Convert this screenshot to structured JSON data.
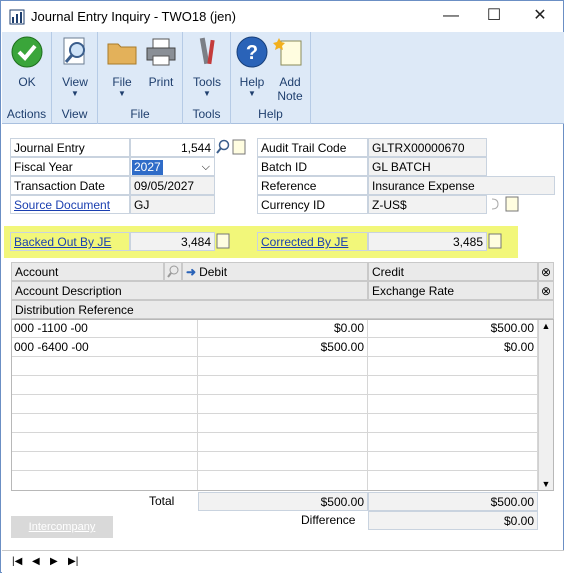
{
  "window": {
    "title": "Journal Entry Inquiry  -  TWO18 (jen)"
  },
  "ribbon": {
    "groups": [
      {
        "label": "Actions",
        "buttons": [
          {
            "label": "OK",
            "icon": "check-icon"
          }
        ]
      },
      {
        "label": "View",
        "buttons": [
          {
            "label": "View",
            "icon": "magnifier-document-icon"
          }
        ]
      },
      {
        "label": "File",
        "buttons": [
          {
            "label": "File",
            "icon": "folder-icon"
          },
          {
            "label": "Print",
            "icon": "printer-icon"
          }
        ]
      },
      {
        "label": "Tools",
        "buttons": [
          {
            "label": "Tools",
            "icon": "tools-icon"
          }
        ]
      },
      {
        "label": "Help",
        "buttons": [
          {
            "label": "Help",
            "icon": "help-icon"
          },
          {
            "label": "Add Note",
            "icon": "add-note-icon"
          }
        ]
      }
    ]
  },
  "form": {
    "journal_entry_label": "Journal Entry",
    "journal_entry_value": "1,544",
    "fiscal_year_label": "Fiscal Year",
    "fiscal_year_value": "2027",
    "transaction_date_label": "Transaction Date",
    "transaction_date_value": "09/05/2027",
    "source_document_label": "Source Document",
    "source_document_value": "GJ",
    "audit_trail_label": "Audit Trail Code",
    "audit_trail_value": "GLTRX00000670",
    "batch_id_label": "Batch ID",
    "batch_id_value": "GL BATCH",
    "reference_label": "Reference",
    "reference_value": "Insurance Expense",
    "currency_id_label": "Currency ID",
    "currency_id_value": "Z-US$",
    "backed_out_label": "Backed Out By JE",
    "backed_out_value": "3,484",
    "corrected_label": "Corrected By JE",
    "corrected_value": "3,485"
  },
  "grid": {
    "headers": {
      "account": "Account",
      "debit": "Debit",
      "credit": "Credit",
      "account_description": "Account Description",
      "exchange_rate": "Exchange Rate",
      "distribution_reference": "Distribution Reference"
    },
    "rows": [
      {
        "account": "000 -1100 -00",
        "debit": "$0.00",
        "credit": "$500.00"
      },
      {
        "account": "000 -6400 -00",
        "debit": "$500.00",
        "credit": "$0.00"
      }
    ],
    "total_label": "Total",
    "total_debit": "$500.00",
    "total_credit": "$500.00",
    "difference_label": "Difference",
    "difference_value": "$0.00"
  },
  "buttons": {
    "intercompany": "Intercompany"
  },
  "colors": {
    "highlight": "#f2f77a",
    "ribbon_bg": "#dde9f7",
    "link": "#1a3fb0"
  }
}
